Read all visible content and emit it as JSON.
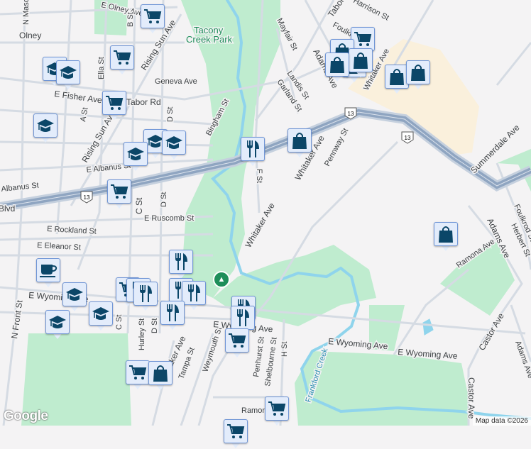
{
  "map": {
    "labels": {
      "olney_ave": "E Olney Ave",
      "mascher": "N Mascher St",
      "olney": "Olney",
      "b_st_n": "B St",
      "rising_sun_1": "Rising Sun Ave",
      "tacony_1": "Tacony",
      "tacony_2": "Creek Park",
      "ella": "Ella St",
      "geneva": "Geneva Ave",
      "fisher": "E Fisher Ave",
      "tabor_w": "Tabor Rd",
      "d_st_n": "D St",
      "bingham": "Bingham St",
      "a_st": "A St",
      "rising_sun_2": "Rising Sun Ave",
      "e_albanus": "E Albanus St",
      "albanus": "Albanus St",
      "blvd": "Blvd",
      "c_st_mid": "C St",
      "d_st_mid": "D St",
      "mayfair": "Mayfair St",
      "tabor_e": "Tabor Rd",
      "harrison": "Harrison St",
      "foulkrod_n": "Foulkrod St",
      "adams_n": "Adams Ave",
      "landis": "Landis St",
      "garland": "Garland St",
      "whitaker_ne": "Whitaker Ave",
      "whitaker_mid": "Whitaker Ave",
      "pennway": "Pennway St",
      "f_st": "F St",
      "summerdale": "Summerdale Ave",
      "ruscomb": "E Ruscomb St",
      "rockland": "E Rockland St",
      "eleanor": "E Eleanor St",
      "whitaker_s": "Whitaker Ave",
      "front": "N Front St",
      "wyoming_w": "E Wyoming Ave",
      "c_st_s": "C St",
      "hurley": "Hurley St",
      "d_st_s": "D St",
      "whitaker_sw": "Whitaker Ave",
      "tampa": "Tampa St",
      "weymouth": "Weymouth St",
      "penhurst": "Penhurst St",
      "shelbourne": "Shelbourne St",
      "h_st": "H St",
      "wyoming_mid": "E Wyoming Ave",
      "wyoming_e1": "E Wyoming Ave",
      "wyoming_e2": "E Wyoming Ave",
      "frankford_creek": "Frankford Creek",
      "ramona_e": "Ramona Ave",
      "adams_e": "Adams Ave",
      "herbert": "Herbert St",
      "foulkrod_e": "Foulkrod St",
      "castor_1": "Castor Ave",
      "castor_2": "Castor Ave",
      "adams_se": "Adams Ave",
      "ramona_s": "Ramona Ave"
    },
    "route_shield": "13",
    "attribution": "Map data ©2026",
    "logo": "Google",
    "colors": {
      "park": "#bfeccf",
      "water": "#8fd4ec",
      "highway": "#8fa5c1",
      "mall": "#faf0dc",
      "marker_icon": "#0b4668"
    },
    "marker_types": [
      "shopping-cart",
      "school",
      "restaurant",
      "shopping-bag",
      "coffee",
      "park"
    ]
  }
}
